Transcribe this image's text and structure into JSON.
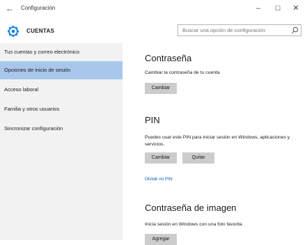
{
  "window": {
    "title": "Configuración",
    "back_glyph": "←",
    "minimize_glyph": "–",
    "maximize_glyph": "☐",
    "close_glyph": "✕"
  },
  "header": {
    "section_title": "CUENTAS",
    "search_placeholder": "Buscar una opción de configuración"
  },
  "sidebar": {
    "items": [
      {
        "label": "Tus cuentas y correo electrónico",
        "selected": false
      },
      {
        "label": "Opciones de inicio de sesión",
        "selected": true
      },
      {
        "label": "Acceso laboral",
        "selected": false
      },
      {
        "label": "Familia y otros usuarios",
        "selected": false
      },
      {
        "label": "Sincronizar configuración",
        "selected": false
      }
    ]
  },
  "main": {
    "password": {
      "title": "Contraseña",
      "description": "Cambiar la contraseña de tu cuenta",
      "change_label": "Cambiar"
    },
    "pin": {
      "title": "PIN",
      "description": "Puedes usar este PIN para iniciar sesión en Windows, aplicaciones y servicios.",
      "change_label": "Cambiar",
      "remove_label": "Quitar",
      "forgot_link": "Olvidé mi PIN"
    },
    "picture_password": {
      "title": "Contraseña de imagen",
      "description": "Inicia sesión en Windows con una foto favorita",
      "add_label": "Agregar"
    }
  },
  "colors": {
    "selected_nav": "#a9c7ec",
    "sidebar_bg": "#f2f2f2",
    "button_bg": "#cccccc",
    "link": "#0063b1",
    "accent_icon": "#0078d7"
  },
  "icons": {
    "back": "back-arrow-icon",
    "settings": "gear-icon",
    "search": "search-icon"
  }
}
